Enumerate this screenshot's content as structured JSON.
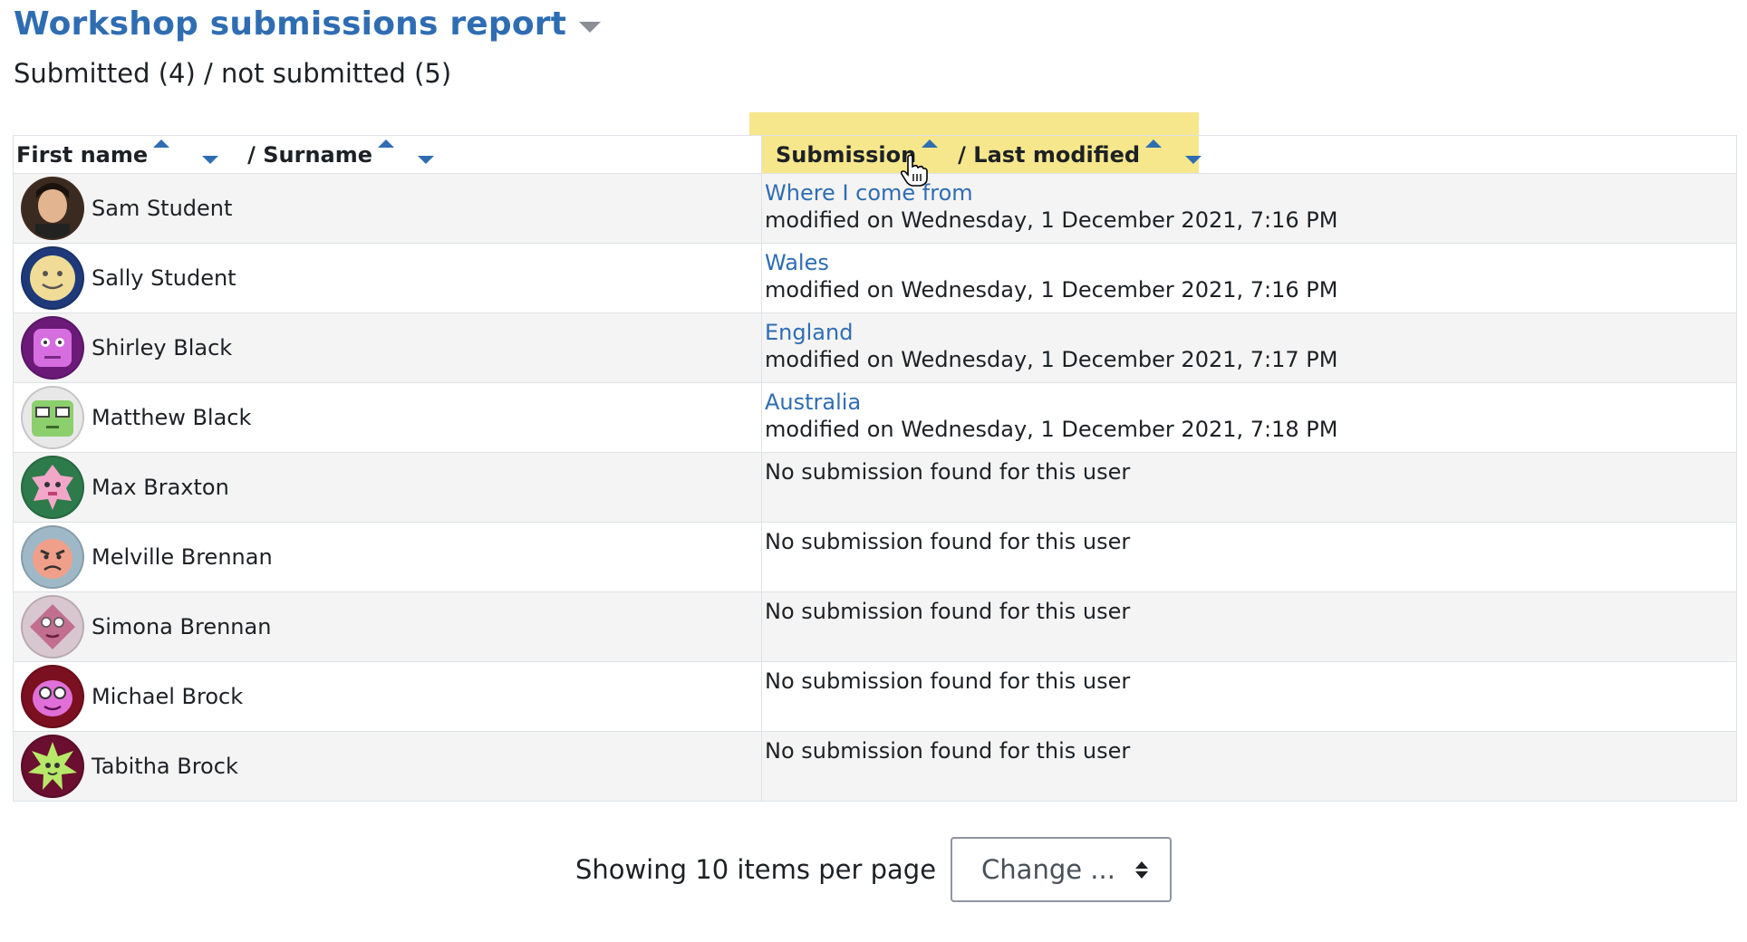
{
  "page": {
    "title": "Workshop submissions report",
    "subtitle": "Submitted (4) / not submitted (5)"
  },
  "table": {
    "headers": {
      "first_name": "First name",
      "surname": "/ Surname",
      "submission": "Submission",
      "last_modified": "/ Last modified"
    },
    "rows": [
      {
        "name": "Sam Student",
        "avatar": "photo-avatar",
        "avatar_color": "#4a3326",
        "submission": "Where I come from",
        "modified": "modified on Wednesday, 1 December 2021, 7:16 PM"
      },
      {
        "name": "Sally Student",
        "avatar": "smiley-avatar",
        "avatar_color": "#1f3a7a",
        "submission": "Wales",
        "modified": "modified on Wednesday, 1 December 2021, 7:16 PM"
      },
      {
        "name": "Shirley Black",
        "avatar": "purple-monster-avatar",
        "avatar_color": "#b13fb8",
        "submission": "England",
        "modified": "modified on Wednesday, 1 December 2021, 7:17 PM"
      },
      {
        "name": "Matthew Black",
        "avatar": "green-monster-avatar",
        "avatar_color": "#8ccf6d",
        "submission": "Australia",
        "modified": "modified on Wednesday, 1 December 2021, 7:18 PM"
      },
      {
        "name": "Max Braxton",
        "avatar": "pink-monster-avatar",
        "avatar_color": "#2d7a4a",
        "submission": "",
        "modified": "",
        "nosub": "No submission found for this user"
      },
      {
        "name": "Melville Brennan",
        "avatar": "grumpy-avatar",
        "avatar_color": "#9fb8c7",
        "submission": "",
        "modified": "",
        "nosub": "No submission found for this user"
      },
      {
        "name": "Simona Brennan",
        "avatar": "diamond-avatar",
        "avatar_color": "#c26f8f",
        "submission": "",
        "modified": "",
        "nosub": "No submission found for this user"
      },
      {
        "name": "Michael Brock",
        "avatar": "glasses-avatar",
        "avatar_color": "#7a1020",
        "submission": "",
        "modified": "",
        "nosub": "No submission found for this user"
      },
      {
        "name": "Tabitha Brock",
        "avatar": "star-avatar",
        "avatar_color": "#6a0f2f",
        "submission": "",
        "modified": "",
        "nosub": "No submission found for this user"
      }
    ]
  },
  "pager": {
    "text": "Showing 10 items per page",
    "select_value": "Change ..."
  },
  "colors": {
    "link": "#2f6db3",
    "highlight": "#f6e68c"
  }
}
